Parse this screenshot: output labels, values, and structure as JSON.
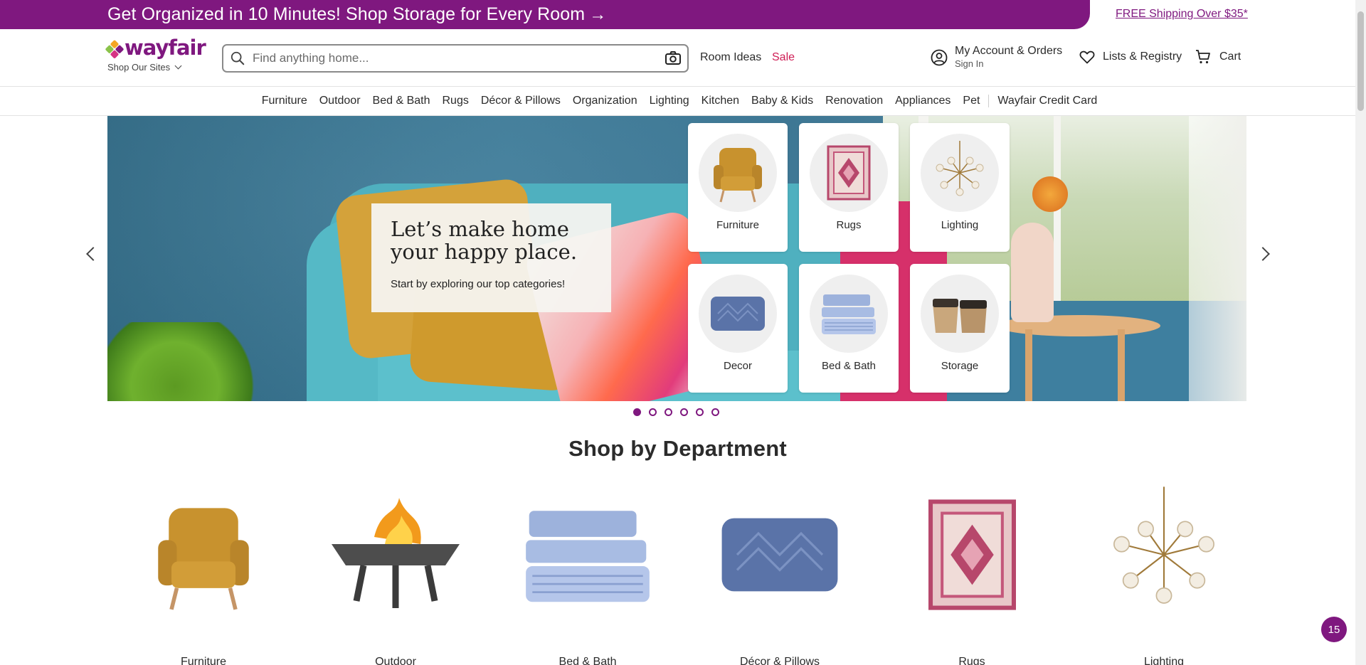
{
  "promo": {
    "text": "Get Organized in 10 Minutes! Shop Storage for Every Room",
    "arrow": "→",
    "shipping": "FREE Shipping Over $35*",
    "color": "#7f187f"
  },
  "header": {
    "logo": "wayfair",
    "shop_sites": "Shop Our Sites",
    "search_placeholder": "Find anything home...",
    "room_ideas": "Room Ideas",
    "sale": "Sale",
    "account_title": "My Account & Orders",
    "account_sub": "Sign In",
    "lists": "Lists & Registry",
    "cart": "Cart"
  },
  "nav": {
    "items": [
      "Furniture",
      "Outdoor",
      "Bed & Bath",
      "Rugs",
      "Décor & Pillows",
      "Organization",
      "Lighting",
      "Kitchen",
      "Baby & Kids",
      "Renovation",
      "Appliances",
      "Pet"
    ],
    "credit_card": "Wayfair Credit Card"
  },
  "hero": {
    "title": "Let’s make home your happy place.",
    "subtitle": "Start by exploring our top categories!",
    "tiles": [
      "Furniture",
      "Rugs",
      "Lighting",
      "Decor",
      "Bed & Bath",
      "Storage"
    ],
    "slide_count": 6,
    "active_slide": 1
  },
  "departments": {
    "title": "Shop by Department",
    "items": [
      "Furniture",
      "Outdoor",
      "Bed & Bath",
      "Décor & Pillows",
      "Rugs",
      "Lighting"
    ]
  },
  "chat_badge": "15",
  "colors": {
    "brand": "#7f187f",
    "sale": "#cf1d55"
  }
}
